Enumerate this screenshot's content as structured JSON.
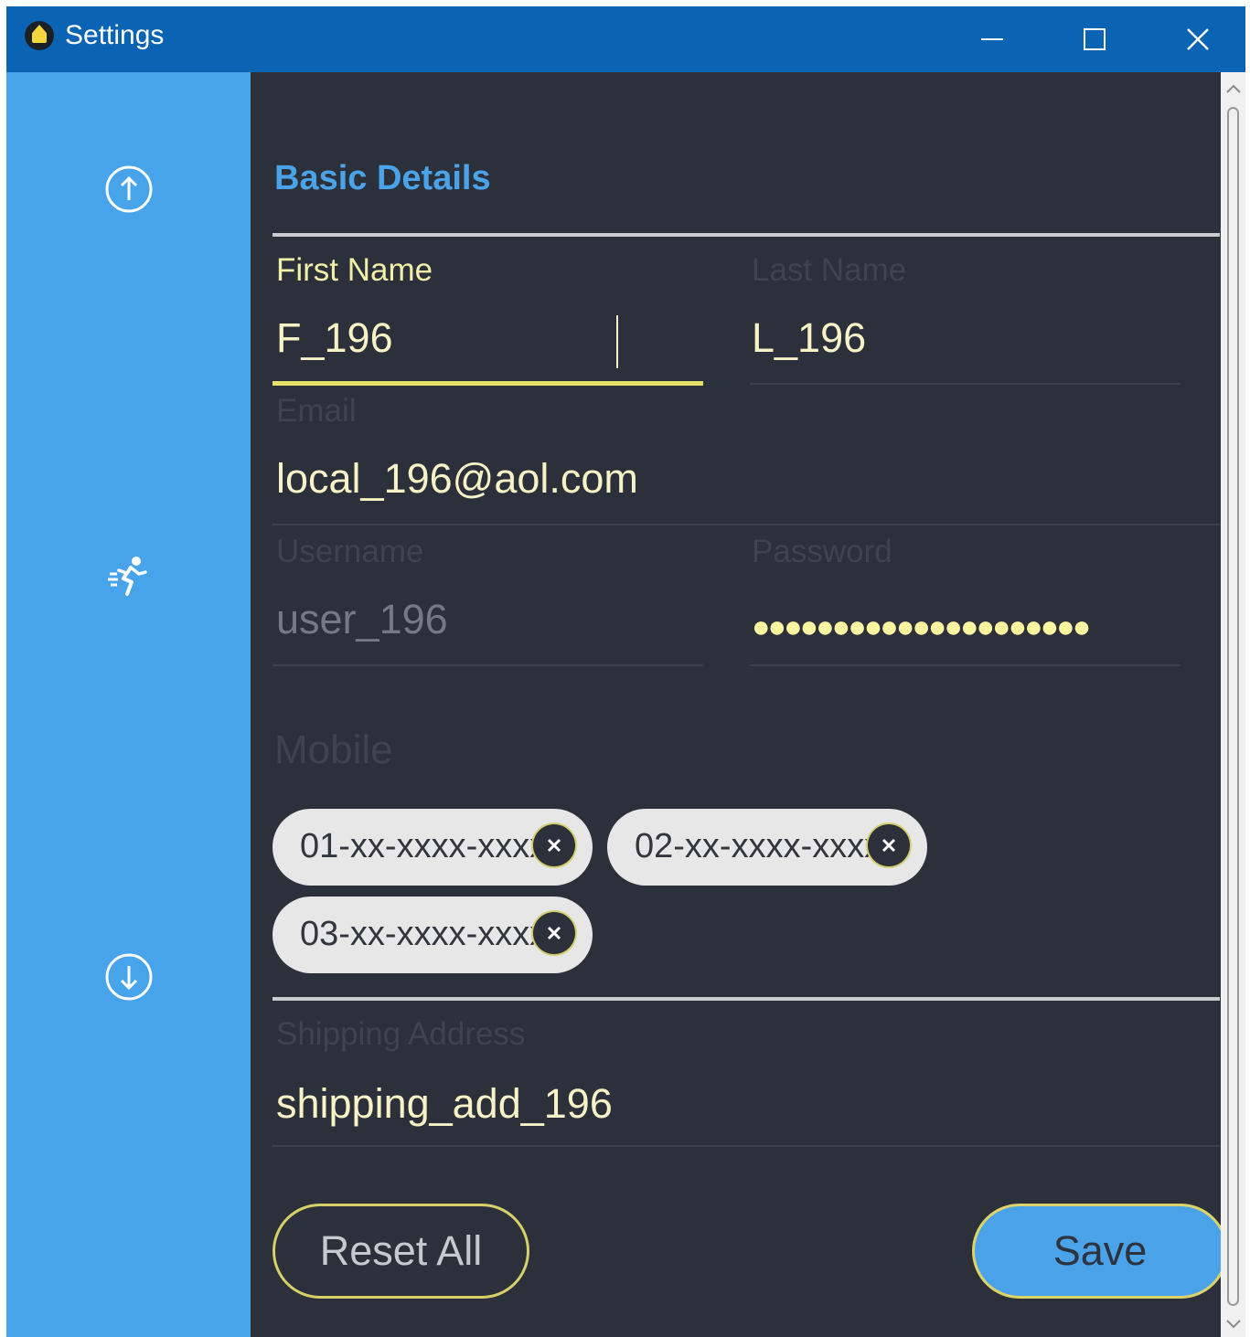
{
  "window": {
    "title": "Settings"
  },
  "form": {
    "section_title": "Basic Details",
    "first_name": {
      "label": "First Name",
      "value": "F_196"
    },
    "last_name": {
      "label": "Last Name",
      "value": "L_196"
    },
    "email": {
      "label": "Email",
      "value": "local_196@aol.com"
    },
    "username": {
      "label": "Username",
      "value": "user_196"
    },
    "password": {
      "label": "Password",
      "value": "●●●●●●●●●●●●●●●●●●●●●"
    },
    "mobile": {
      "label": "Mobile",
      "chips": [
        "01-xx-xxxx-xxxx",
        "02-xx-xxxx-xxxx",
        "03-xx-xxxx-xxxx"
      ]
    },
    "shipping": {
      "label": "Shipping Address",
      "value": "shipping_add_196"
    }
  },
  "buttons": {
    "reset_label": "Reset All",
    "save_label": "Save"
  },
  "colors": {
    "titlebar": "#0a63b3",
    "sidebar": "#47a3ea",
    "panel": "#2c303b",
    "accent_yellow": "#e6df6b",
    "heading_blue": "#4aa3e9"
  }
}
